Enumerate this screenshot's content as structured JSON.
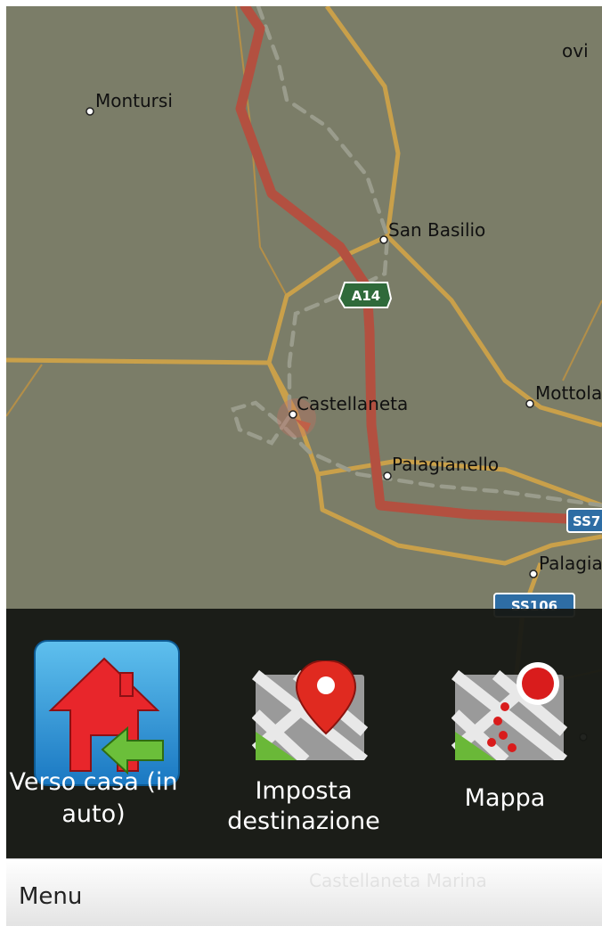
{
  "map": {
    "towns": [
      {
        "id": "montursi",
        "label": "Montursi"
      },
      {
        "id": "san-basilio",
        "label": "San Basilio"
      },
      {
        "id": "castellaneta",
        "label": "Castellaneta"
      },
      {
        "id": "palagianello",
        "label": "Palagianello"
      },
      {
        "id": "mottola",
        "label": "Mottola"
      },
      {
        "id": "palagiano",
        "label": "Palagia"
      },
      {
        "id": "partial-ovi",
        "label": "ovi"
      }
    ],
    "shields": {
      "a14": "A14",
      "ss7": "SS7",
      "ss106": "SS106"
    },
    "colors": {
      "background": "#7b7d68",
      "route": "#b35040",
      "main_road": "#c9a04a",
      "dashed": "#9a9c8c"
    }
  },
  "quick_actions": [
    {
      "id": "home",
      "label_line1": "Verso casa (in",
      "label_line2": "auto)",
      "icon": "home-arrow-icon"
    },
    {
      "id": "destination",
      "label_line1": "Imposta",
      "label_line2": "destinazione",
      "icon": "map-pin-icon"
    },
    {
      "id": "map",
      "label_line1": "Mappa",
      "icon": "map-route-icon"
    }
  ],
  "menubar": {
    "label": "Menu",
    "ghost_text": "Castellaneta Marina"
  }
}
